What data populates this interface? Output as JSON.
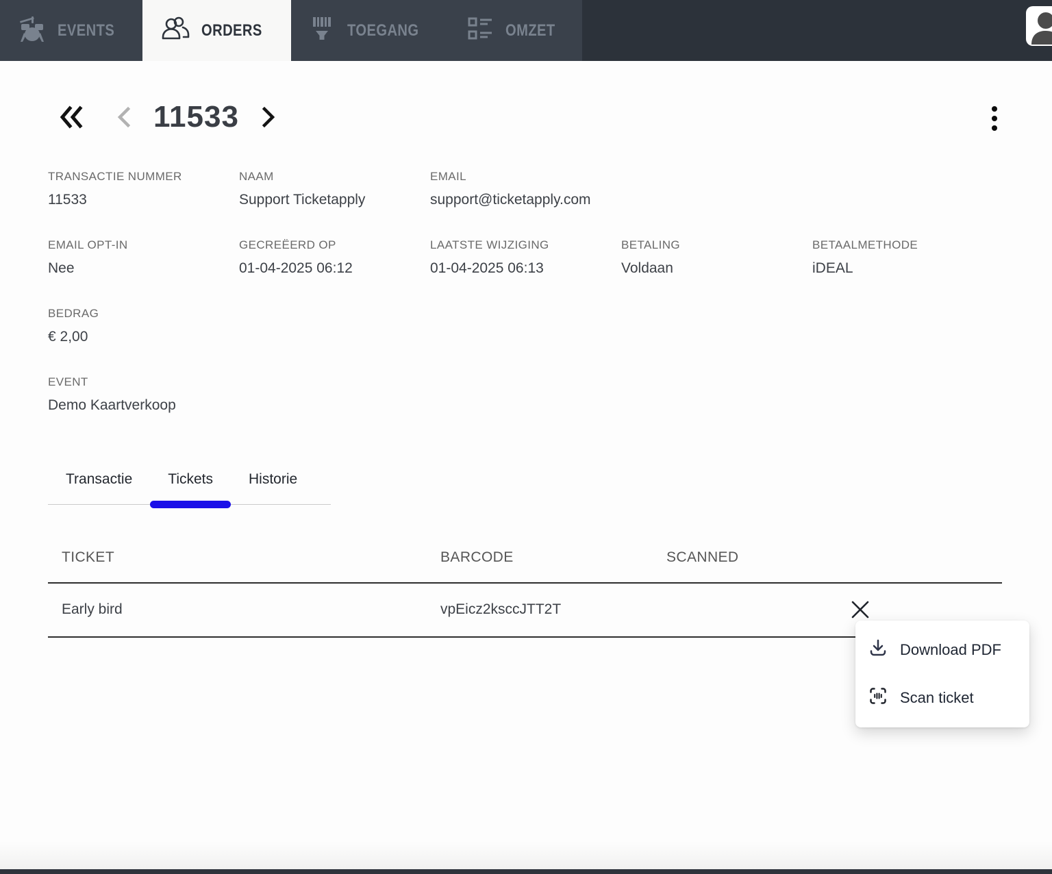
{
  "colors": {
    "nav_bg": "#2c323a",
    "tabstrip_bg": "#3a414b",
    "active_tab_bg": "#f8f8f7",
    "accent_blue": "#1b10e8",
    "text_dark": "#3d4147",
    "label_gray": "#6a6a6a"
  },
  "nav": {
    "tabs": [
      {
        "label": "EVENTS",
        "icon": "drums-icon"
      },
      {
        "label": "ORDERS",
        "icon": "people-icon",
        "active": true
      },
      {
        "label": "TOEGANG",
        "icon": "barcode-scan-icon"
      },
      {
        "label": "OMZET",
        "icon": "list-icon"
      }
    ]
  },
  "pager": {
    "order_id": "11533"
  },
  "details": {
    "rows": [
      [
        {
          "label": "TRANSACTIE NUMMER",
          "value": "11533"
        },
        {
          "label": "NAAM",
          "value": "Support Ticketapply"
        },
        {
          "label": "EMAIL",
          "value": "support@ticketapply.com"
        }
      ],
      [
        {
          "label": "EMAIL OPT-IN",
          "value": "Nee"
        },
        {
          "label": "GECREËERD OP",
          "value": "01-04-2025 06:12"
        },
        {
          "label": "LAATSTE WIJZIGING",
          "value": "01-04-2025 06:13"
        },
        {
          "label": "BETALING",
          "value": "Voldaan"
        },
        {
          "label": "BETAALMETHODE",
          "value": "iDEAL"
        }
      ],
      [
        {
          "label": "BEDRAG",
          "value": "€ 2,00"
        }
      ],
      [
        {
          "label": "EVENT",
          "value": "Demo Kaartverkoop"
        }
      ]
    ]
  },
  "subtabs": [
    {
      "label": "Transactie"
    },
    {
      "label": "Tickets",
      "active": true
    },
    {
      "label": "Historie"
    }
  ],
  "table": {
    "headers": [
      "TICKET",
      "BARCODE",
      "SCANNED"
    ],
    "rows": [
      {
        "ticket": "Early bird",
        "barcode": "vpEicz2ksccJTT2T",
        "scanned_icon": "x-icon"
      }
    ]
  },
  "menu": {
    "items": [
      {
        "label": "Download PDF",
        "icon": "download-icon"
      },
      {
        "label": "Scan ticket",
        "icon": "scan-icon"
      }
    ]
  }
}
